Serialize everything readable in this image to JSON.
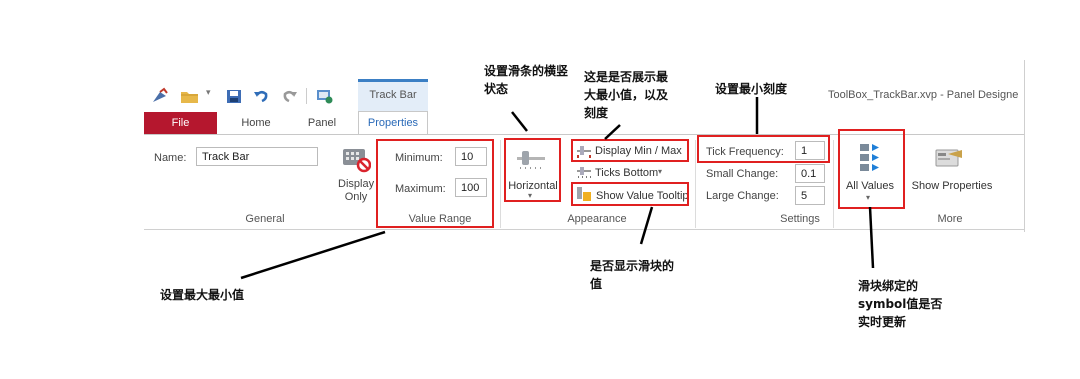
{
  "window": {
    "title": "ToolBox_TrackBar.xvp - Panel Designe"
  },
  "contextual_tab": {
    "label": "Track Bar"
  },
  "tabs": [
    {
      "label": "File"
    },
    {
      "label": "Home"
    },
    {
      "label": "Panel"
    },
    {
      "label": "Properties"
    }
  ],
  "general": {
    "name_label": "Name:",
    "name_value": "Track Bar",
    "display_only_label": "Display Only",
    "group_label": "General"
  },
  "value_range": {
    "min_label": "Minimum:",
    "min_value": "10",
    "max_label": "Maximum:",
    "max_value": "100",
    "group_label": "Value Range"
  },
  "appearance": {
    "orientation_label": "Horizontal",
    "display_minmax_label": "Display Min / Max",
    "ticks_label": "Ticks Bottom",
    "tooltip_label": "Show Value Tooltip",
    "group_label": "Appearance"
  },
  "settings": {
    "tick_freq_label": "Tick Frequency:",
    "tick_freq_value": "1",
    "small_change_label": "Small Change:",
    "small_change_value": "0.1",
    "large_change_label": "Large Change:",
    "large_change_value": "5",
    "group_label": "Settings"
  },
  "all_values": {
    "label": "All Values"
  },
  "more": {
    "show_properties_label": "Show Properties",
    "group_label": "More"
  },
  "annotations": {
    "orientation": "设置滑条的横竖状态",
    "minmax": "这是是否展示最大最小值，以及刻度",
    "tick": "设置最小刻度",
    "range": "设置最大最小值",
    "tooltip": "是否显示滑块的值",
    "symbol": "滑块绑定的symbol值是否实时更新"
  },
  "colors": {
    "file_tab": "#b5172e",
    "contextual": "#3b7fc4",
    "annotation_box": "#e02020"
  }
}
